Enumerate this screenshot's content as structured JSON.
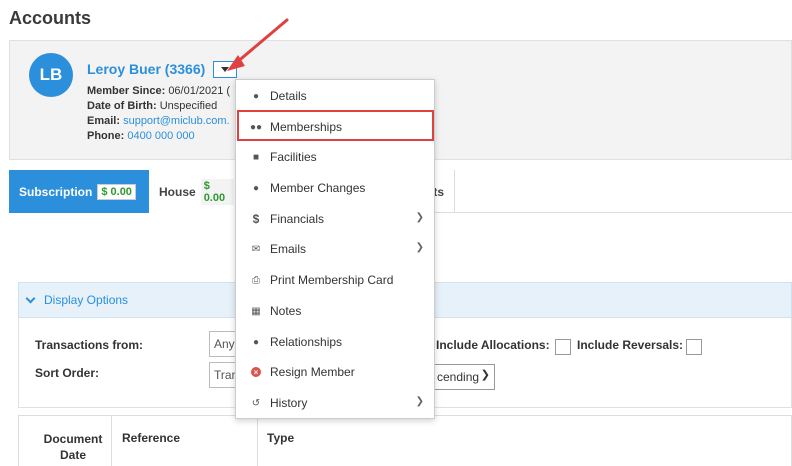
{
  "page_title": "Accounts",
  "member": {
    "initials": "LB",
    "name": "Leroy Buer (3366)",
    "member_since_label": "Member Since:",
    "member_since_value": "06/01/2021 (",
    "dob_label": "Date of Birth:",
    "dob_value": "Unspecified",
    "email_label": "Email:",
    "email_value": "support@miclub.com.",
    "phone_label": "Phone:",
    "phone_value": "0400 000 000"
  },
  "tabs": [
    {
      "label": "Subscription",
      "amount": "$ 0.00"
    },
    {
      "label": "House",
      "amount": "$ 0.00"
    },
    {
      "label": "ts"
    }
  ],
  "display_options": {
    "label": "Display Options"
  },
  "options": {
    "transactions_from_label": "Transactions from:",
    "transactions_from_value": "Any",
    "sort_order_label": "Sort Order:",
    "sort_order_value": "Trar",
    "include_allocations_label": "Include Allocations:",
    "include_reversals_label": "Include Reversals:",
    "sort_direction_value": "cending"
  },
  "table": {
    "columns": [
      "Document Date",
      "Reference",
      "Type"
    ],
    "col_document_line1": "Document",
    "col_document_line2": "Date"
  },
  "menu": {
    "items": [
      {
        "label": "Details",
        "icon": "person-icon"
      },
      {
        "label": "Memberships",
        "icon": "group-icon"
      },
      {
        "label": "Facilities",
        "icon": "puzzle-icon"
      },
      {
        "label": "Member Changes",
        "icon": "person-icon"
      },
      {
        "label": "Financials",
        "icon": "dollar-icon",
        "submenu": true
      },
      {
        "label": "Emails",
        "icon": "envelope-icon",
        "submenu": true
      },
      {
        "label": "Print Membership Card",
        "icon": "print-icon"
      },
      {
        "label": "Notes",
        "icon": "notes-icon"
      },
      {
        "label": "Relationships",
        "icon": "person-icon"
      },
      {
        "label": "Resign Member",
        "icon": "close-circle-icon"
      },
      {
        "label": "History",
        "icon": "history-icon",
        "submenu": true
      }
    ]
  },
  "colors": {
    "accent": "#2b8fdc",
    "highlight": "#e04040",
    "amount": "#2e9a2e"
  }
}
